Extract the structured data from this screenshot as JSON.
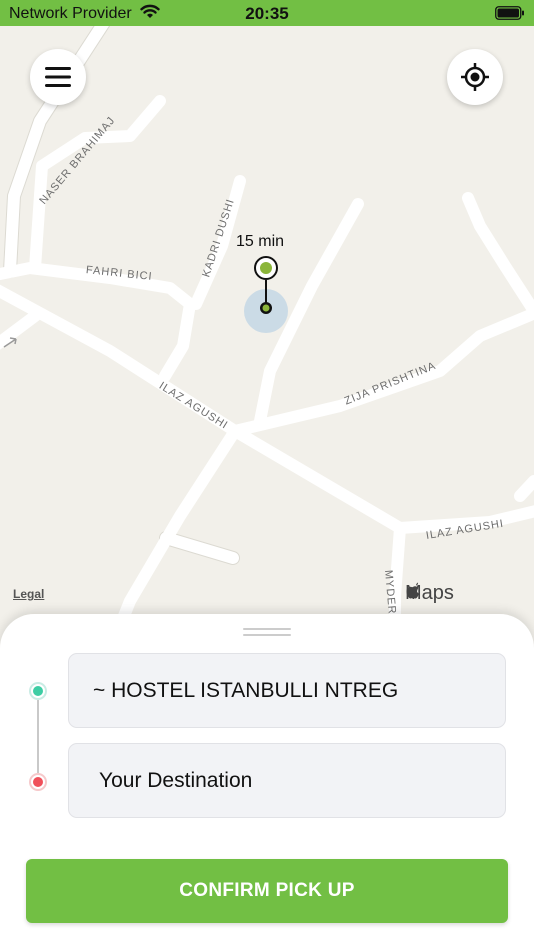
{
  "status_bar": {
    "carrier": "Network Provider",
    "time": "20:35"
  },
  "map": {
    "eta": "15 min",
    "legal": "Legal",
    "attribution": "Maps",
    "streets": [
      "NASER BRAHIMAJ",
      "FAHRI BICI",
      "KADRI DUSHI",
      "ILAZ AGUSHI",
      "ZIJA PRISHTINA",
      "ILAZ AGUSHI",
      "MYDERRI"
    ]
  },
  "sheet": {
    "pickup_value": "~ HOSTEL ISTANBULLI NTREG",
    "destination_placeholder": "Your Destination",
    "confirm_label": "CONFIRM PICK UP"
  },
  "colors": {
    "accent": "#72bf44",
    "pickup_dot": "#3ecda4",
    "destination_dot": "#f0505a"
  },
  "icons": {
    "menu": "hamburger-icon",
    "locate": "crosshair-icon"
  }
}
